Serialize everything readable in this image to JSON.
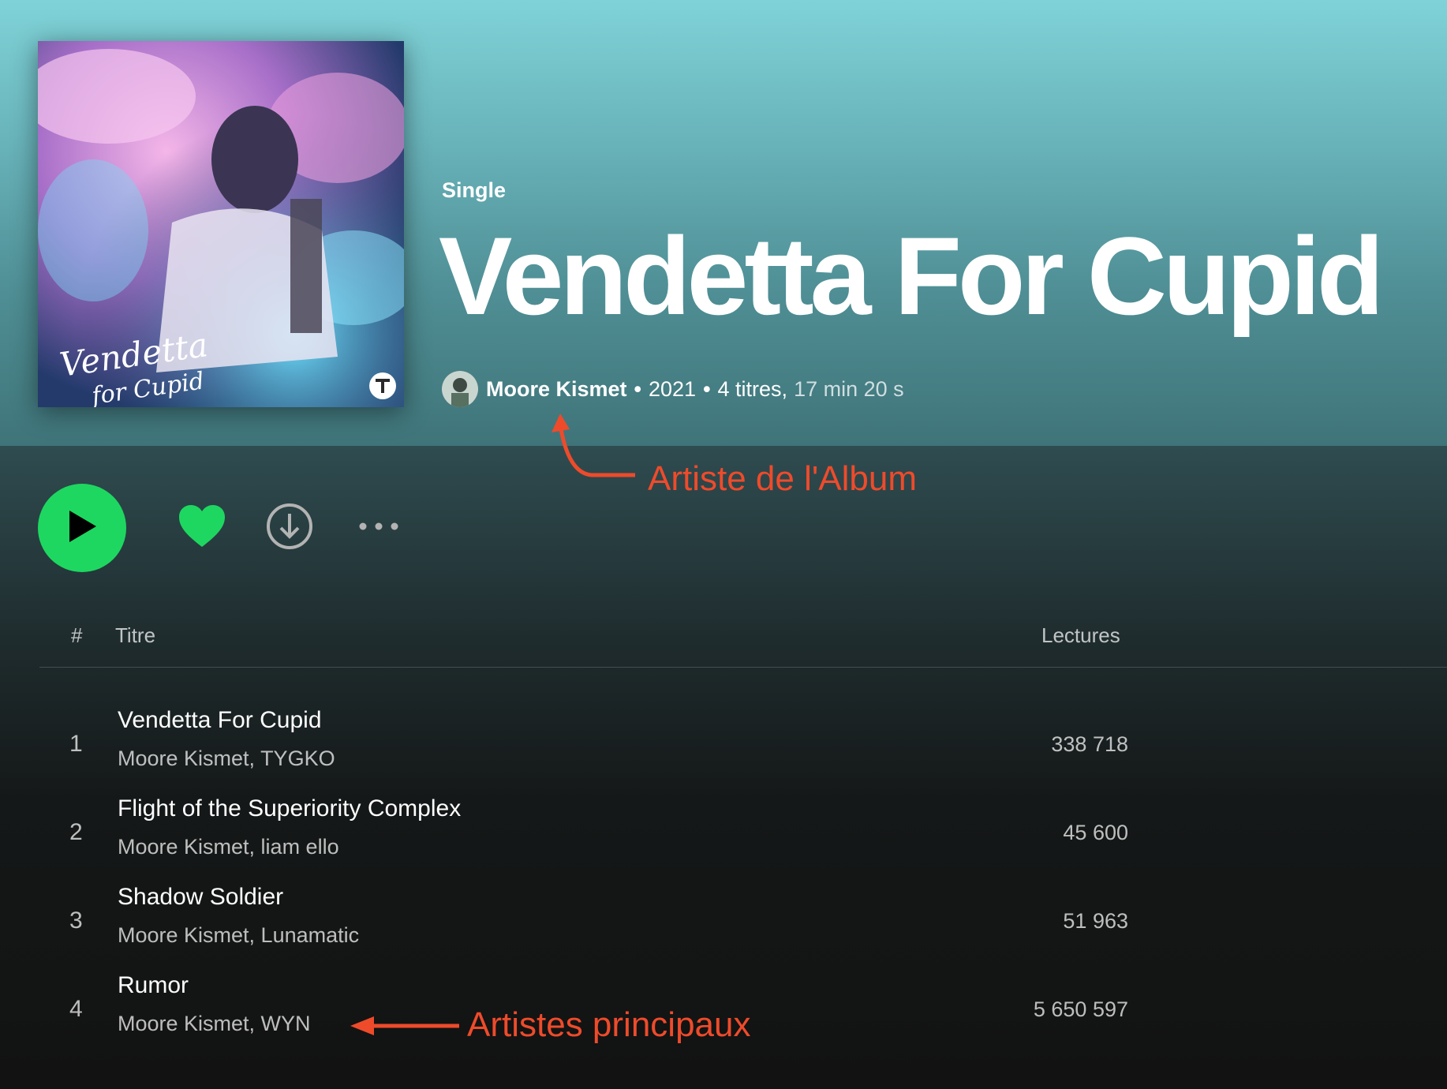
{
  "album": {
    "type_label": "Single",
    "title": "Vendetta For Cupid",
    "artist": "Moore Kismet",
    "sep1": "•",
    "year": "2021",
    "sep2": "•",
    "tracks_count": "4 titres,",
    "duration": "17 min 20 s"
  },
  "cover_art": {
    "logo_text": "Vendetta For Cupid",
    "badge_icon": "label-logo-icon"
  },
  "controls": {
    "play_icon": "play-icon",
    "like_icon": "heart-icon",
    "download_icon": "download-icon",
    "more_icon": "more-icon"
  },
  "table": {
    "col_num": "#",
    "col_title": "Titre",
    "col_plays": "Lectures"
  },
  "tracks": [
    {
      "num": "1",
      "title": "Vendetta For Cupid",
      "artists": "Moore Kismet, TYGKO",
      "plays": "338 718"
    },
    {
      "num": "2",
      "title": "Flight of the Superiority Complex",
      "artists": "Moore Kismet, liam ello",
      "plays": "45 600"
    },
    {
      "num": "3",
      "title": "Shadow Soldier",
      "artists": "Moore Kismet, Lunamatic",
      "plays": "51 963"
    },
    {
      "num": "4",
      "title": "Rumor",
      "artists": "Moore Kismet, WYN",
      "plays": "5 650 597"
    }
  ],
  "annotations": {
    "album_artist": "Artiste de l'Album",
    "main_artists": "Artistes principaux"
  },
  "colors": {
    "accent_green": "#1ed760",
    "annotation_red": "#ee4b2b"
  }
}
